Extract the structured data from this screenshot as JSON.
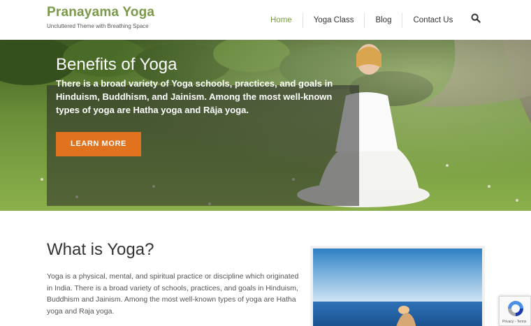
{
  "site": {
    "title": "Pranayama Yoga",
    "tagline": "Uncluttered Theme with Breathing Space"
  },
  "nav": {
    "items": [
      {
        "label": "Home",
        "active": true
      },
      {
        "label": "Yoga Class",
        "active": false
      },
      {
        "label": "Blog",
        "active": false
      },
      {
        "label": "Contact Us",
        "active": false
      }
    ],
    "search_icon": "search-icon"
  },
  "hero": {
    "title": "Benefits of Yoga",
    "text": "There is a broad variety of Yoga schools, practices, and goals in Hinduism, Buddhism, and Jainism. Among the most well-known types of yoga are Hatha yoga and Rāja yoga.",
    "button_label": "LEARN MORE"
  },
  "content": {
    "title": "What is Yoga?",
    "text": "Yoga is a physical, mental, and spiritual practice or discipline which originated in India. There is a broad variety of schools, practices, and goals in Hinduism, Buddhism and Jainism. Among the most well-known types of yoga are Hatha yoga and Raja yoga."
  },
  "recaptcha": {
    "text": "Privacy - Terms"
  },
  "colors": {
    "brand": "#7a9a4a",
    "button": "#e2731e"
  }
}
